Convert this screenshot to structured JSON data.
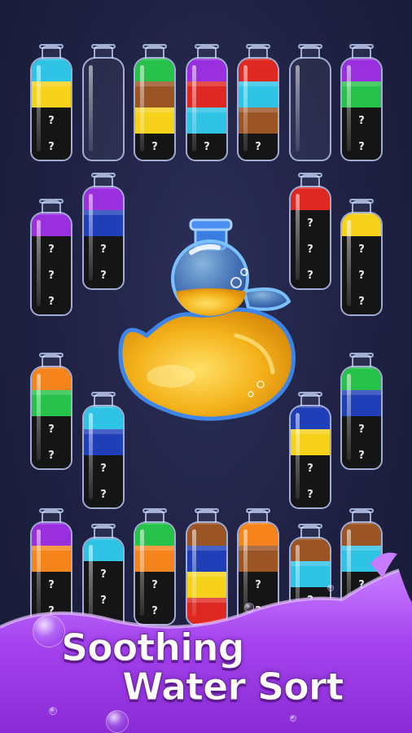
{
  "title": {
    "line1": "Soothing",
    "line2": "Water Sort"
  },
  "unknown_mark": "?",
  "colors": {
    "cyan": "#2fc3e6",
    "yellow": "#f6d21a",
    "green": "#27c24a",
    "brown": "#9b5424",
    "purple": "#9a2fe0",
    "red": "#e02822",
    "blue": "#1f3fb8",
    "orange": "#f5841c",
    "unknown": "#151515",
    "duck_liquid": "#f4b21b",
    "splash": "#b24cf0"
  },
  "bottles": [
    {
      "id": "r1-1",
      "layers": [
        "cyan",
        "yellow",
        "unknown",
        "unknown"
      ]
    },
    {
      "id": "r1-2",
      "layers": []
    },
    {
      "id": "r1-3",
      "layers": [
        "green",
        "brown",
        "yellow",
        "unknown"
      ]
    },
    {
      "id": "r1-4",
      "layers": [
        "purple",
        "red",
        "cyan",
        "unknown"
      ]
    },
    {
      "id": "r1-5",
      "layers": [
        "red",
        "cyan",
        "brown",
        "unknown"
      ]
    },
    {
      "id": "r1-6",
      "layers": []
    },
    {
      "id": "r1-7",
      "layers": [
        "purple",
        "green",
        "unknown",
        "unknown"
      ]
    },
    {
      "id": "r2-1",
      "layers": [
        "purple",
        "unknown",
        "unknown",
        "unknown"
      ]
    },
    {
      "id": "r2-2",
      "layers": [
        "purple",
        "blue",
        "unknown",
        "unknown"
      ]
    },
    {
      "id": "r2-3",
      "layers": [
        "red",
        "unknown",
        "unknown",
        "unknown"
      ]
    },
    {
      "id": "r2-4",
      "layers": [
        "yellow",
        "unknown",
        "unknown",
        "unknown"
      ]
    },
    {
      "id": "r3-1",
      "layers": [
        "orange",
        "green",
        "unknown",
        "unknown"
      ]
    },
    {
      "id": "r3-2",
      "layers": [
        "cyan",
        "blue",
        "unknown",
        "unknown"
      ]
    },
    {
      "id": "r3-3",
      "layers": [
        "blue",
        "yellow",
        "unknown",
        "unknown"
      ]
    },
    {
      "id": "r3-4",
      "layers": [
        "green",
        "blue",
        "unknown",
        "unknown"
      ]
    },
    {
      "id": "r4-1",
      "layers": [
        "purple",
        "orange",
        "unknown",
        "unknown"
      ]
    },
    {
      "id": "r4-2",
      "layers": [
        "cyan",
        "unknown",
        "unknown",
        "unknown"
      ]
    },
    {
      "id": "r4-3",
      "layers": [
        "green",
        "orange",
        "unknown",
        "unknown"
      ]
    },
    {
      "id": "r4-4",
      "layers": [
        "brown",
        "blue",
        "yellow",
        "red"
      ]
    },
    {
      "id": "r4-5",
      "layers": [
        "orange",
        "brown",
        "unknown",
        "unknown"
      ]
    },
    {
      "id": "r4-6",
      "layers": [
        "brown",
        "cyan",
        "unknown",
        "unknown"
      ]
    },
    {
      "id": "r4-7",
      "layers": [
        "brown",
        "cyan",
        "unknown",
        "unknown"
      ]
    }
  ]
}
